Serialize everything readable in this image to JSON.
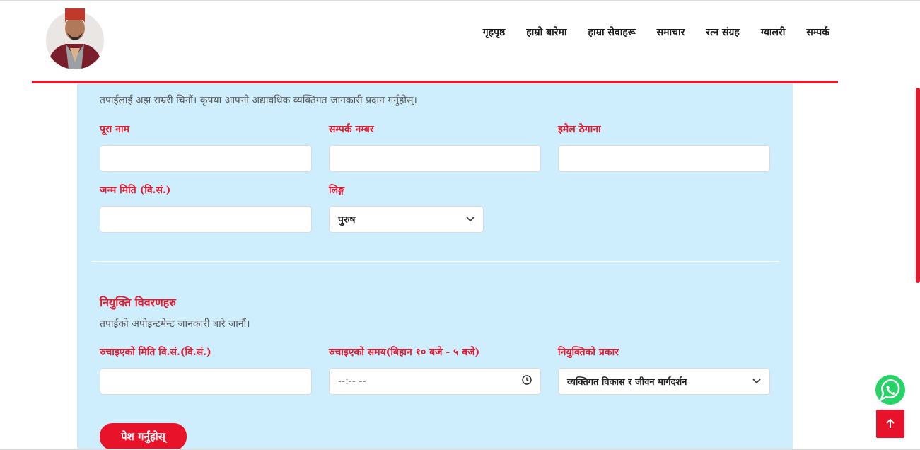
{
  "nav": {
    "items": [
      {
        "label": "गृहपृष्ठ"
      },
      {
        "label": "हाम्रो बारेमा"
      },
      {
        "label": "हाम्रा सेवाहरू"
      },
      {
        "label": "समाचार"
      },
      {
        "label": "रत्न संग्रह"
      },
      {
        "label": "ग्यालरी"
      },
      {
        "label": "सम्पर्क"
      }
    ]
  },
  "form": {
    "intro": "तपाईंलाई अझ राम्ररी चिनौं। कृपया आफ्नो अद्यावधिक व्यक्तिगत जानकारी प्रदान गर्नुहोस्।",
    "full_name_label": "पूरा नाम",
    "contact_label": "सम्पर्क नम्बर",
    "email_label": "इमेल ठेगाना",
    "dob_label": "जन्म मिति (वि.सं.)",
    "gender_label": "लिङ्ग",
    "gender_value": "पुरुष",
    "appointment_title": "नियुक्ति विवरणहरु",
    "appointment_sub": "तपाईंको अपोइन्टमेन्ट जानकारी बारे जानौं।",
    "pref_date_label": "रुचाइएको मिति वि.सं.(वि.सं.)",
    "pref_time_label": "रुचाइएको समय(बिहान १० बजे - ५ बजे)",
    "time_value": "--:-- --",
    "appt_type_label": "नियुक्तिको प्रकार",
    "appt_type_value": "व्यक्तिगत विकास र जीवन मार्गदर्शन",
    "submit_label": "पेश गर्नुहोस्"
  },
  "colors": {
    "accent": "#e01b2f",
    "panel": "#cfeefd"
  },
  "icons": {
    "whatsapp": "whatsapp-icon",
    "to_top": "arrow-up-icon",
    "clock": "clock-icon",
    "chevron": "chevron-down-icon"
  }
}
